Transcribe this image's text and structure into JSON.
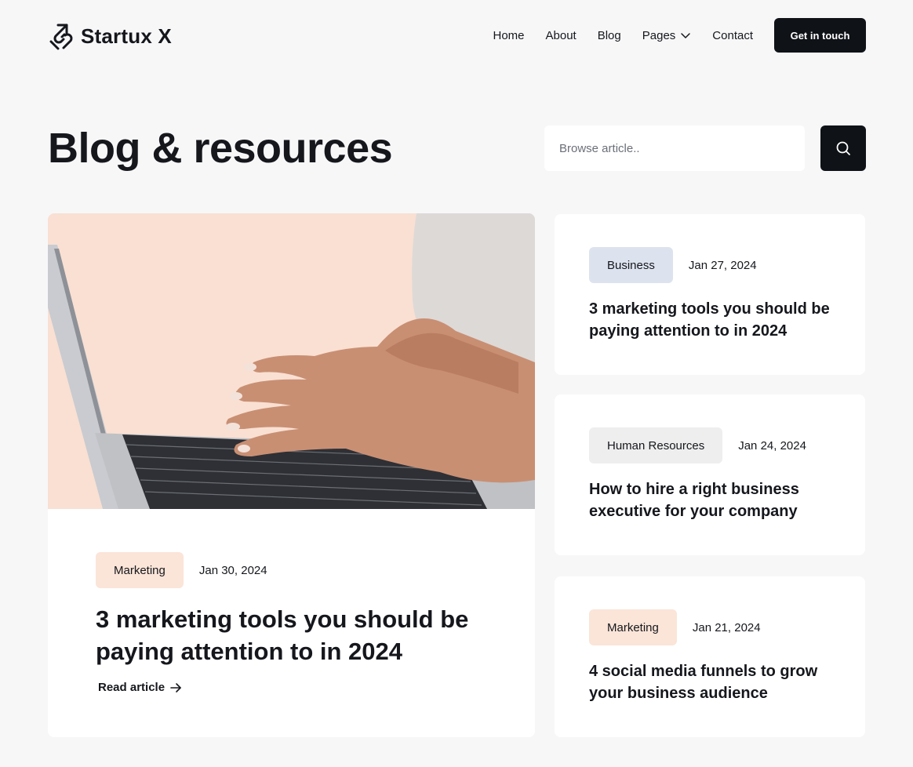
{
  "brand": {
    "name": "Startux X",
    "logo_icon": "arrow-link-icon"
  },
  "nav": {
    "items": [
      {
        "label": "Home"
      },
      {
        "label": "About"
      },
      {
        "label": "Blog"
      },
      {
        "label": "Pages",
        "icon": "chevron-down-icon"
      },
      {
        "label": "Contact"
      }
    ],
    "cta_label": "Get in touch"
  },
  "page": {
    "title": "Blog & resources"
  },
  "search": {
    "placeholder": "Browse article..",
    "value": "",
    "icon": "search-icon"
  },
  "featured": {
    "tag": "Marketing",
    "date": "Jan 30, 2024",
    "title": "3 marketing tools you should be paying attention to in 2024",
    "read_label": "Read article",
    "read_icon": "arrow-right-icon"
  },
  "posts": [
    {
      "tag": "Business",
      "date": "Jan 27, 2024",
      "title": "3 marketing tools you should be paying attention to in 2024"
    },
    {
      "tag": "Human Resources",
      "date": "Jan 24, 2024",
      "title": "How to hire a right business executive for your company"
    },
    {
      "tag": "Marketing",
      "date": "Jan 21, 2024",
      "title": "4 social media funnels to grow your business audience"
    }
  ],
  "colors": {
    "background": "#f7f7f8",
    "dark": "#0f1217",
    "tag_marketing": "#fbe4d8",
    "tag_business": "#dde3ee",
    "tag_hr": "#eeeeee"
  }
}
